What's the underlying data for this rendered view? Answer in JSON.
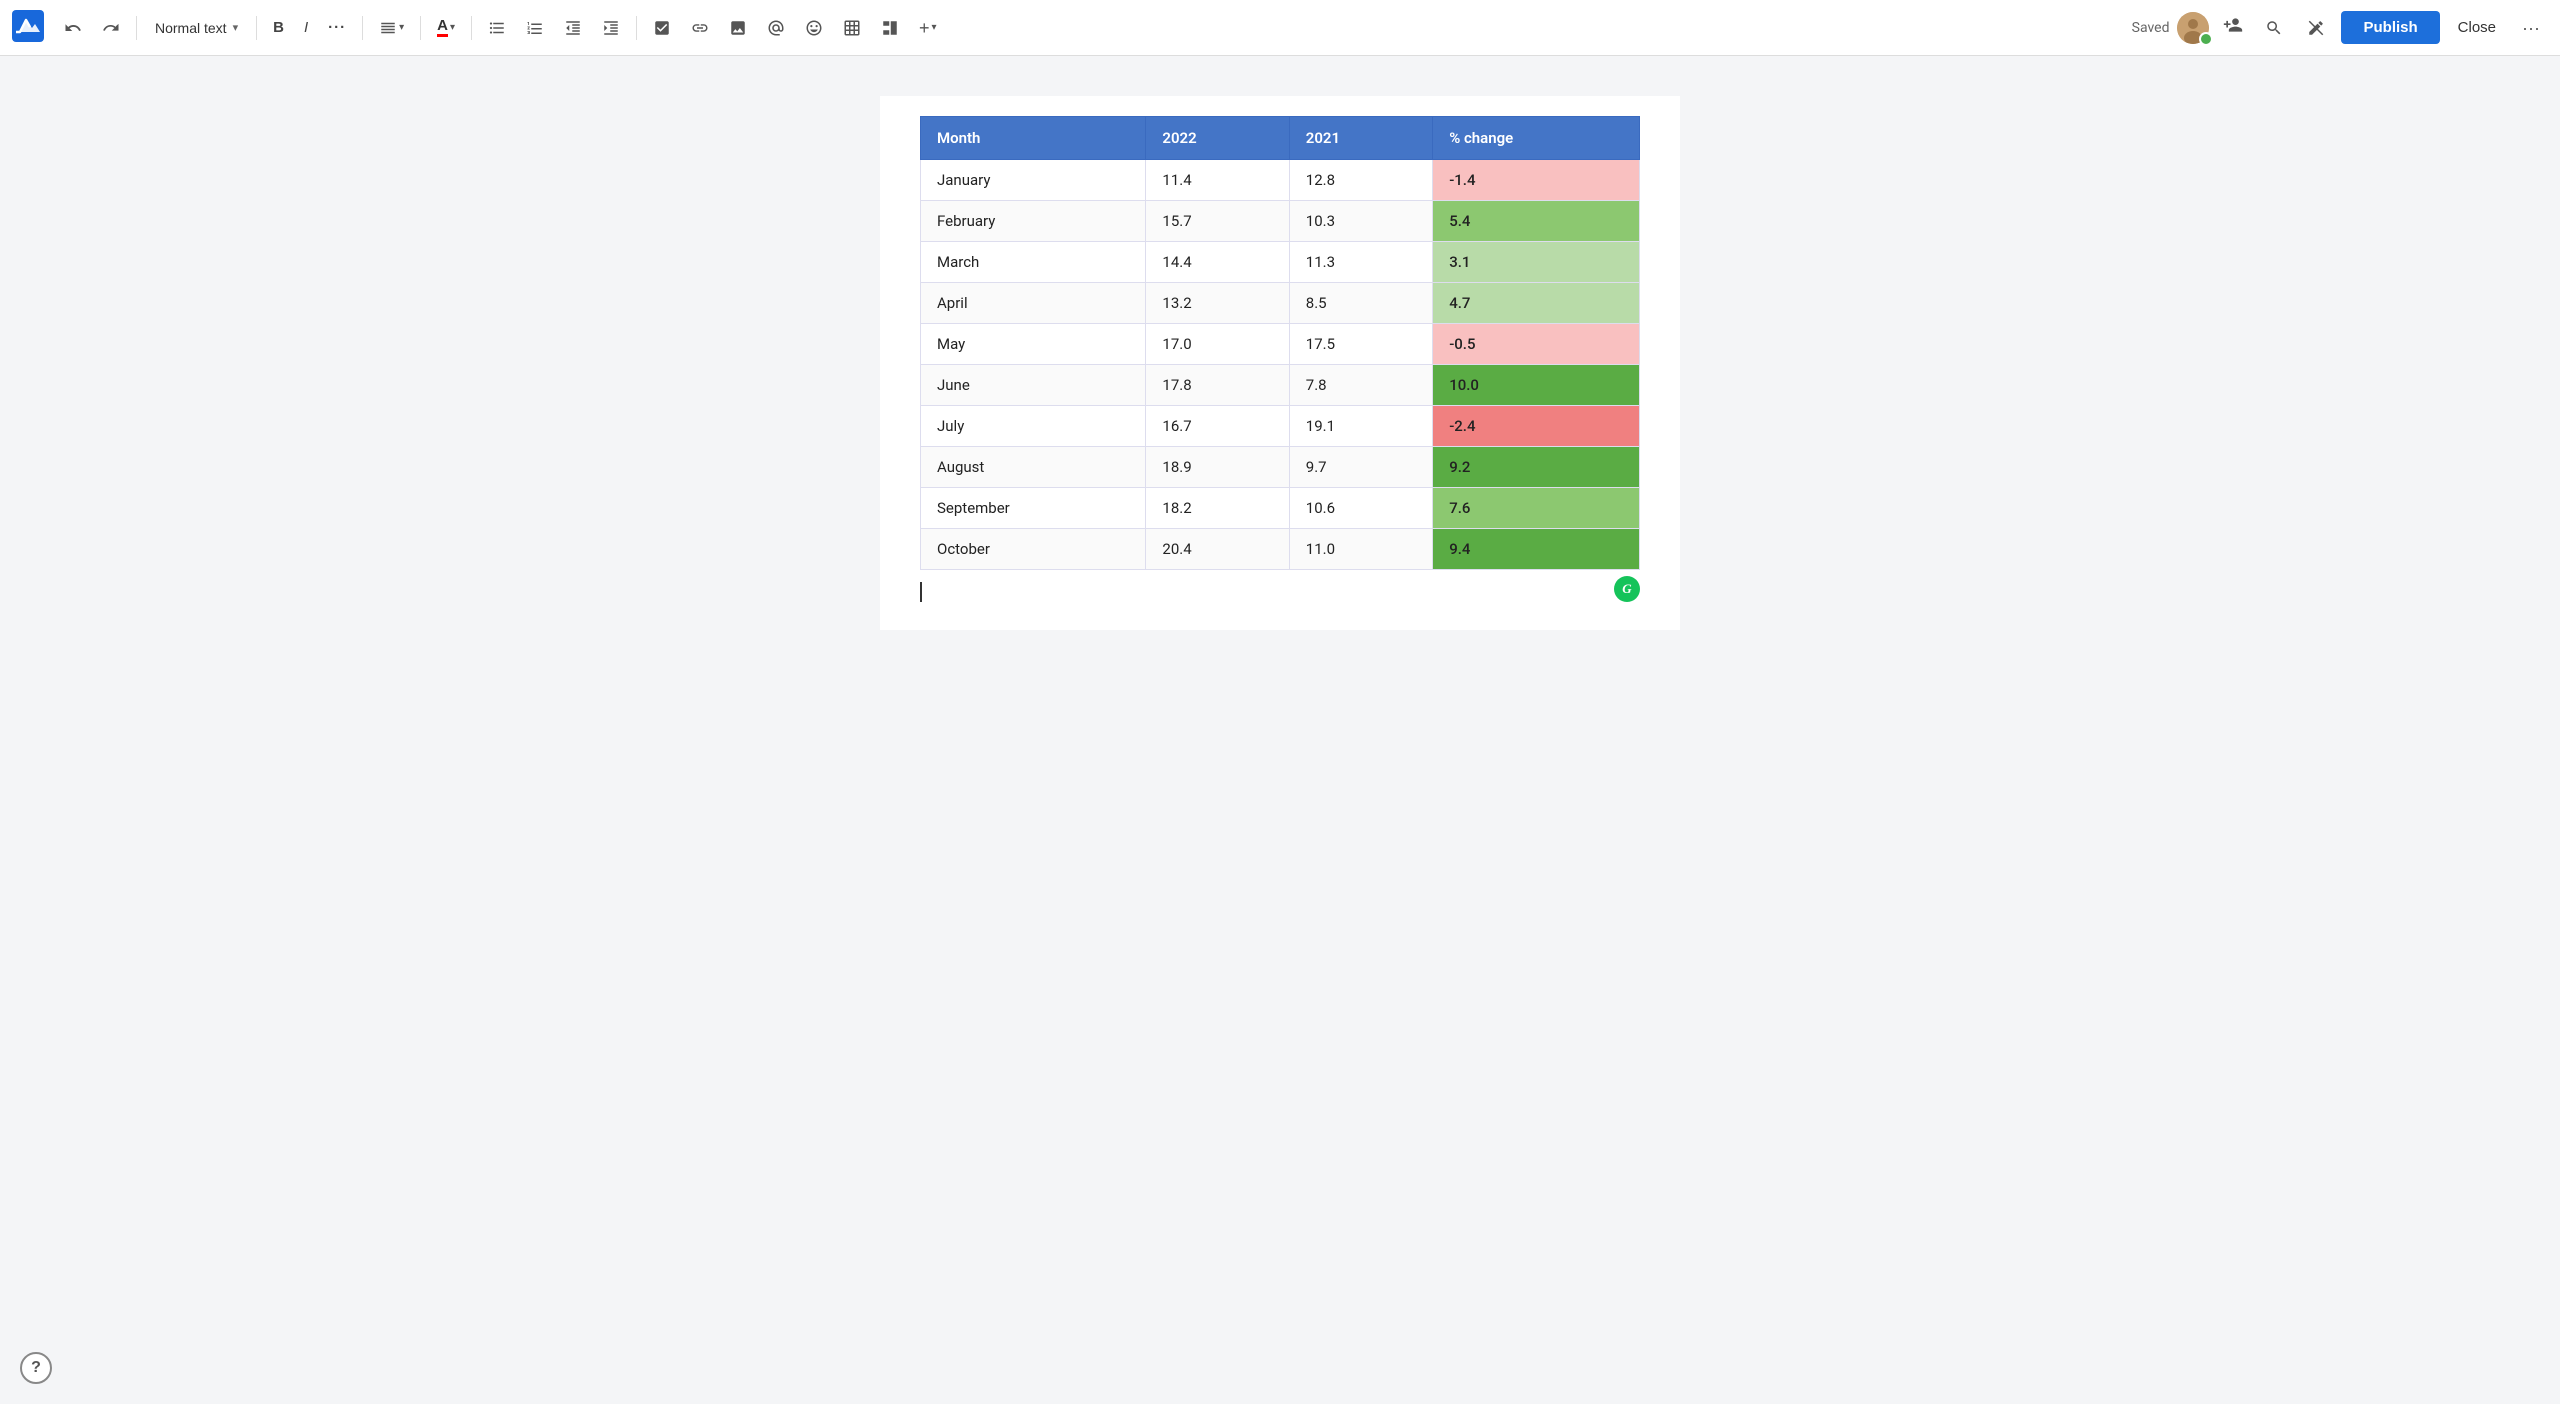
{
  "toolbar": {
    "text_style_label": "Normal text",
    "chevron_down": "▾",
    "undo_label": "↺",
    "redo_label": "↻",
    "bold_label": "B",
    "italic_label": "I",
    "more_formatting_label": "···",
    "align_label": "≡",
    "align_chevron": "▾",
    "text_color_label": "A",
    "list_unordered_label": "≡",
    "list_ordered_label": "≡",
    "list_outdent_label": "⇤",
    "list_indent_label": "⇥",
    "task_label": "☑",
    "link_label": "🔗",
    "media_label": "🖼",
    "mention_label": "@",
    "emoji_label": "☺",
    "table_label": "⊞",
    "layout_label": "▦",
    "insert_label": "+",
    "insert_chevron": "▾",
    "saved_label": "Saved",
    "publish_label": "Publish",
    "close_label": "Close",
    "more_options_label": "···"
  },
  "table": {
    "headers": [
      "Month",
      "2022",
      "2021",
      "% change"
    ],
    "rows": [
      {
        "month": "January",
        "v2022": "11.4",
        "v2021": "12.8",
        "change": "-1.4",
        "change_class": "change-negative-light"
      },
      {
        "month": "February",
        "v2022": "15.7",
        "v2021": "10.3",
        "change": "5.4",
        "change_class": "change-positive-med"
      },
      {
        "month": "March",
        "v2022": "14.4",
        "v2021": "11.3",
        "change": "3.1",
        "change_class": "change-positive-light"
      },
      {
        "month": "April",
        "v2022": "13.2",
        "v2021": "8.5",
        "change": "4.7",
        "change_class": "change-positive-light"
      },
      {
        "month": "May",
        "v2022": "17.0",
        "v2021": "17.5",
        "change": "-0.5",
        "change_class": "change-negative-light"
      },
      {
        "month": "June",
        "v2022": "17.8",
        "v2021": "7.8",
        "change": "10.0",
        "change_class": "change-positive-strong"
      },
      {
        "month": "July",
        "v2022": "16.7",
        "v2021": "19.1",
        "change": "-2.4",
        "change_class": "change-negative-strong"
      },
      {
        "month": "August",
        "v2022": "18.9",
        "v2021": "9.7",
        "change": "9.2",
        "change_class": "change-positive-strong"
      },
      {
        "month": "September",
        "v2022": "18.2",
        "v2021": "10.6",
        "change": "7.6",
        "change_class": "change-positive-med"
      },
      {
        "month": "October",
        "v2022": "20.4",
        "v2021": "11.0",
        "change": "9.4",
        "change_class": "change-positive-strong"
      }
    ]
  },
  "help": {
    "label": "?"
  }
}
